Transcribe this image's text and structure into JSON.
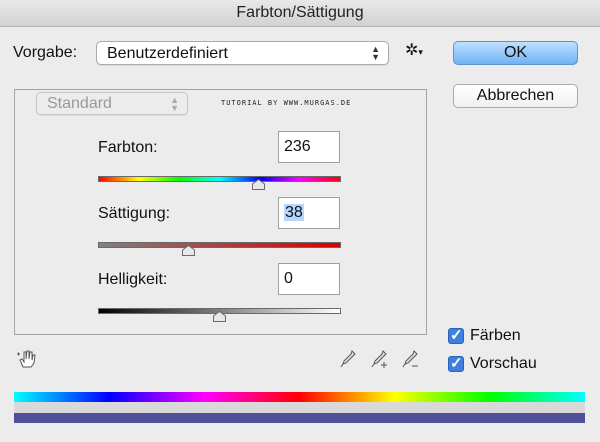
{
  "window": {
    "title": "Farbton/Sättigung"
  },
  "preset": {
    "label": "Vorgabe:",
    "value": "Benutzerdefiniert"
  },
  "buttons": {
    "ok": "OK",
    "cancel": "Abbrechen"
  },
  "channel": {
    "value": "Standard"
  },
  "watermark": "TUTORIAL BY WWW.MURGAS.DE",
  "hue": {
    "label": "Farbton:",
    "value": "236",
    "position": 0.66
  },
  "saturation": {
    "label": "Sättigung:",
    "value": "38",
    "position": 0.38
  },
  "lightness": {
    "label": "Helligkeit:",
    "value": "0",
    "position": 0.5
  },
  "checkboxes": {
    "colorize": "Färben",
    "preview": "Vorschau"
  },
  "colors": {
    "accent": "#3f7fe0",
    "result_bar": "#4f4f9a"
  },
  "icons": [
    "gear-icon",
    "hand-adjust-icon",
    "eyedropper-icon",
    "eyedropper-plus-icon",
    "eyedropper-minus-icon"
  ]
}
